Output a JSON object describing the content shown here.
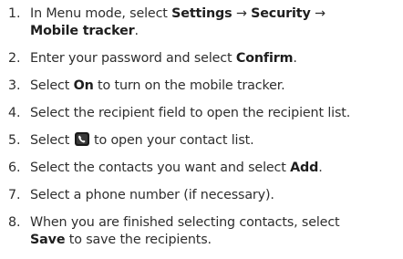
{
  "steps": [
    {
      "number": "1.",
      "t1": "In Menu mode, select ",
      "settings": "Settings",
      "arrow1": " → ",
      "security": "Security",
      "arrow2": " →",
      "mobile_tracker": "Mobile tracker",
      "end": "."
    },
    {
      "number": "2.",
      "t1": "Enter your password and select ",
      "confirm": "Confirm",
      "end": "."
    },
    {
      "number": "3.",
      "t1": "Select ",
      "on": "On",
      "t2": " to turn on the mobile tracker."
    },
    {
      "number": "4.",
      "text": "Select the recipient field to open the recipient list."
    },
    {
      "number": "5.",
      "t1": "Select ",
      "icon": "contacts-phone-icon",
      "t2": " to open your contact list."
    },
    {
      "number": "6.",
      "t1": "Select the contacts you want and select ",
      "add": "Add",
      "end": "."
    },
    {
      "number": "7.",
      "text": "Select a phone number (if necessary)."
    },
    {
      "number": "8.",
      "t1": "When you are finished selecting contacts, select",
      "save": "Save",
      "t2": " to save the recipients."
    }
  ],
  "colors": {
    "text": "#2e2e2e",
    "icon_bg": "#1a1a1a"
  }
}
